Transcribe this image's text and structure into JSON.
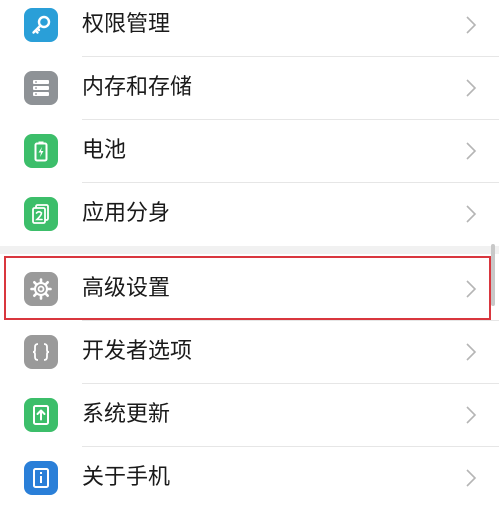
{
  "settings": {
    "items": [
      {
        "label": "权限管理",
        "icon": "key-icon",
        "icon_color": "#2a9fd8"
      },
      {
        "label": "内存和存储",
        "icon": "storage-icon",
        "icon_color": "#8e9296"
      },
      {
        "label": "电池",
        "icon": "battery-icon",
        "icon_color": "#3cbe6a"
      },
      {
        "label": "应用分身",
        "icon": "app-clone-icon",
        "icon_color": "#3cbe6a"
      },
      {
        "label": "高级设置",
        "icon": "gear-icon",
        "icon_color": "#9a9a9a"
      },
      {
        "label": "开发者选项",
        "icon": "braces-icon",
        "icon_color": "#9a9a9a"
      },
      {
        "label": "系统更新",
        "icon": "update-icon",
        "icon_color": "#3cbe6a"
      },
      {
        "label": "关于手机",
        "icon": "phone-info-icon",
        "icon_color": "#2a7fd8"
      }
    ],
    "highlighted": "高级设置"
  }
}
